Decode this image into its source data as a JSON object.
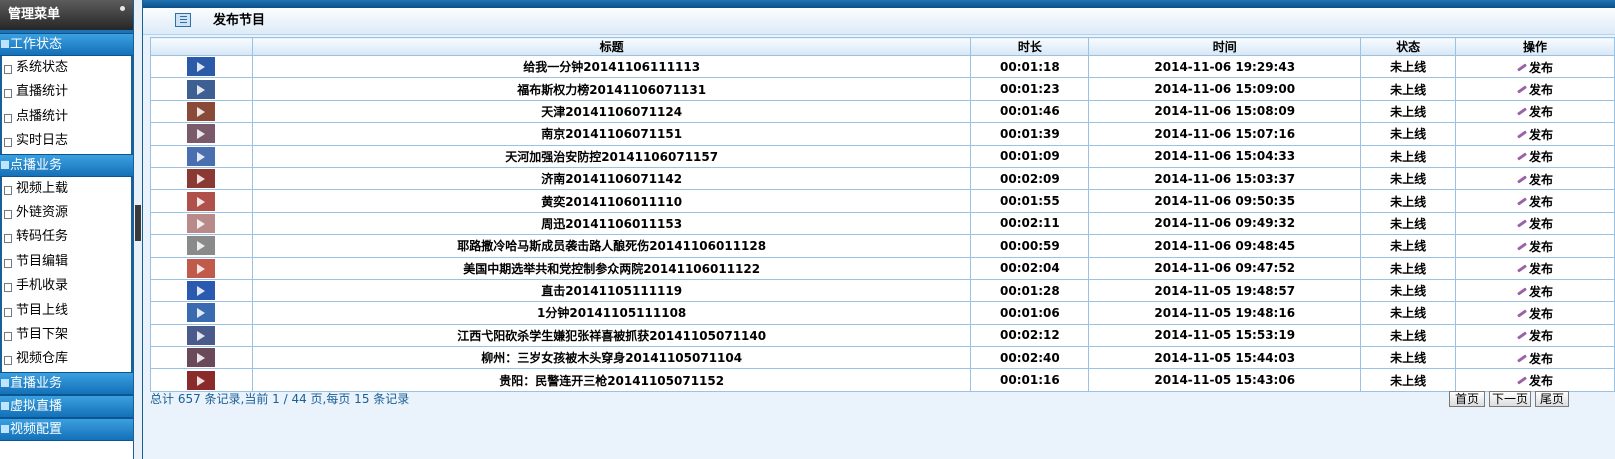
{
  "sidebar": {
    "header": "管理菜单",
    "sections": [
      {
        "label": "工作状态",
        "items": [
          "系统状态",
          "直播统计",
          "点播统计",
          "实时日志"
        ]
      },
      {
        "label": "点播业务",
        "items": [
          "视频上载",
          "外链资源",
          "转码任务",
          "节目编辑",
          "手机收录",
          "节目上线",
          "节目下架",
          "视频仓库"
        ]
      },
      {
        "label": "直播业务",
        "items": []
      },
      {
        "label": "虚拟直播",
        "items": []
      },
      {
        "label": "视频配置",
        "items": []
      }
    ]
  },
  "page": {
    "title": "发布节目"
  },
  "table": {
    "columns": [
      "",
      "标题",
      "时长",
      "时间",
      "状态",
      "操作"
    ],
    "rows": [
      {
        "title": "给我一分钟20141106111113",
        "duration": "00:01:18",
        "time": "2014-11-06 19:29:43",
        "status": "未上线",
        "action": "发布"
      },
      {
        "title": "福布斯权力榜20141106071131",
        "duration": "00:01:23",
        "time": "2014-11-06 15:09:00",
        "status": "未上线",
        "action": "发布"
      },
      {
        "title": "天津20141106071124",
        "duration": "00:01:46",
        "time": "2014-11-06 15:08:09",
        "status": "未上线",
        "action": "发布"
      },
      {
        "title": "南京20141106071151",
        "duration": "00:01:39",
        "time": "2014-11-06 15:07:16",
        "status": "未上线",
        "action": "发布"
      },
      {
        "title": "天河加强治安防控20141106071157",
        "duration": "00:01:09",
        "time": "2014-11-06 15:04:33",
        "status": "未上线",
        "action": "发布"
      },
      {
        "title": "济南20141106071142",
        "duration": "00:02:09",
        "time": "2014-11-06 15:03:37",
        "status": "未上线",
        "action": "发布"
      },
      {
        "title": "黄奕20141106011110",
        "duration": "00:01:55",
        "time": "2014-11-06 09:50:35",
        "status": "未上线",
        "action": "发布"
      },
      {
        "title": "周迅20141106011153",
        "duration": "00:02:11",
        "time": "2014-11-06 09:49:32",
        "status": "未上线",
        "action": "发布"
      },
      {
        "title": "耶路撒冷哈马斯成员袭击路人酿死伤20141106011128",
        "duration": "00:00:59",
        "time": "2014-11-06 09:48:45",
        "status": "未上线",
        "action": "发布"
      },
      {
        "title": "美国中期选举共和党控制参众两院20141106011122",
        "duration": "00:02:04",
        "time": "2014-11-06 09:47:52",
        "status": "未上线",
        "action": "发布"
      },
      {
        "title": "直击20141105111119",
        "duration": "00:01:28",
        "time": "2014-11-05 19:48:57",
        "status": "未上线",
        "action": "发布"
      },
      {
        "title": "1分钟20141105111108",
        "duration": "00:01:06",
        "time": "2014-11-05 19:48:16",
        "status": "未上线",
        "action": "发布"
      },
      {
        "title": "江西弋阳砍杀学生嫌犯张祥喜被抓获20141105071140",
        "duration": "00:02:12",
        "time": "2014-11-05 15:53:19",
        "status": "未上线",
        "action": "发布"
      },
      {
        "title": "柳州：三岁女孩被木头穿身20141105071104",
        "duration": "00:02:40",
        "time": "2014-11-05 15:44:03",
        "status": "未上线",
        "action": "发布"
      },
      {
        "title": "贵阳：民警连开三枪20141105071152",
        "duration": "00:01:16",
        "time": "2014-11-05 15:43:06",
        "status": "未上线",
        "action": "发布"
      }
    ],
    "thumb_colors": [
      "#2b5aa8",
      "#3d5f92",
      "#8a4a3a",
      "#7a5a6a",
      "#4a6fb0",
      "#8a3a32",
      "#b0504a",
      "#b88a8a",
      "#8a8a8a",
      "#c05a4a",
      "#2a5ab0",
      "#3a6ab0",
      "#4a5a8a",
      "#6a4a5a",
      "#8a2a2a"
    ]
  },
  "pagination": {
    "summary": "总计 657 条记录,当前 1 / 44 页,每页 15 条记录",
    "first": "首页",
    "next": "下一页",
    "last": "尾页"
  }
}
